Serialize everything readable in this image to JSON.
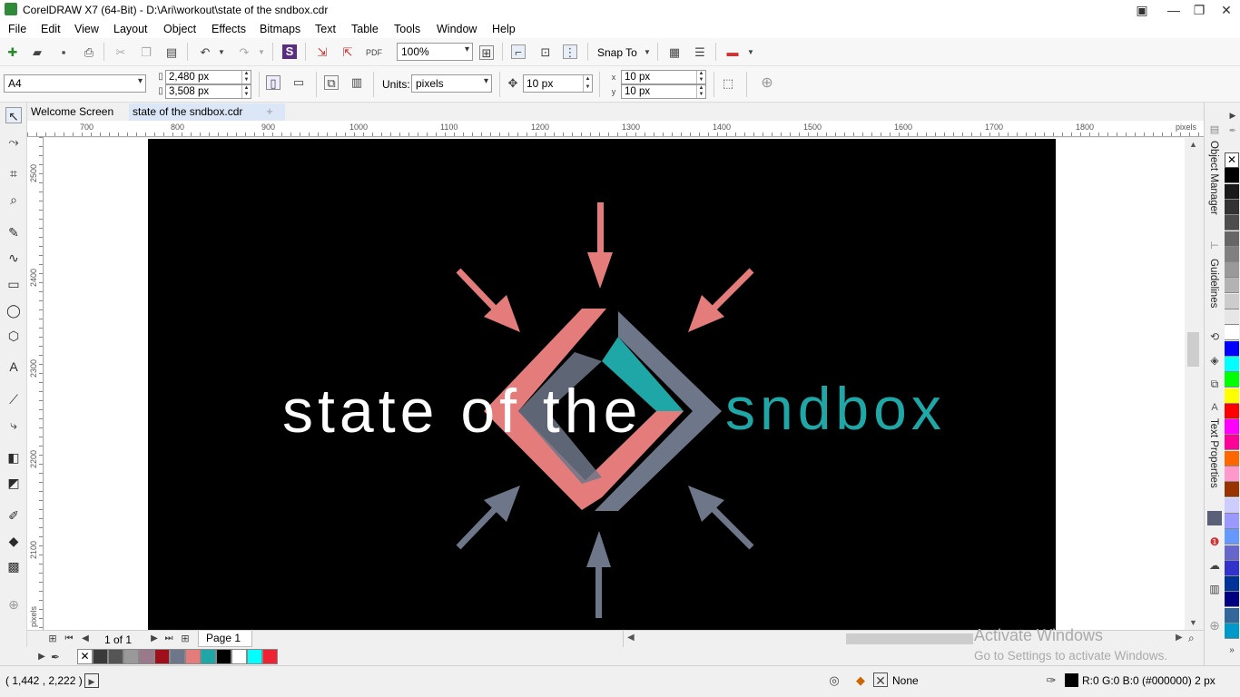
{
  "window": {
    "title": "CorelDRAW X7 (64-Bit) - D:\\Ari\\workout\\state of the sndbox.cdr"
  },
  "menu": [
    "File",
    "Edit",
    "View",
    "Layout",
    "Object",
    "Effects",
    "Bitmaps",
    "Text",
    "Table",
    "Tools",
    "Window",
    "Help"
  ],
  "toolbar": {
    "zoom": "100%",
    "snap_to": "Snap To"
  },
  "property_bar": {
    "page_size": "A4",
    "width": "2,480 px",
    "height": "3,508 px",
    "units_label": "Units:",
    "units": "pixels",
    "nudge": "10 px",
    "dup_x": "10 px",
    "dup_y": "10 px"
  },
  "tabs": [
    {
      "label": "Welcome Screen",
      "active": false
    },
    {
      "label": "state of the sndbox.cdr",
      "active": true
    }
  ],
  "rulers": {
    "horizontal": [
      "700",
      "800",
      "900",
      "1000",
      "1100",
      "1200",
      "1300",
      "1400",
      "1500",
      "1600",
      "1700",
      "1800"
    ],
    "horizontal_unit": "pixels",
    "vertical": [
      "2500",
      "2400",
      "2300",
      "2200",
      "2100"
    ],
    "vertical_unit": "pixels"
  },
  "artwork": {
    "text_left": "state of the",
    "text_right": "sndbox",
    "colors": {
      "background": "#000000",
      "salmon": "#e57c7c",
      "slate": "#6e7789",
      "teal": "#1ea7a6",
      "text": "#ffffff"
    }
  },
  "page_nav": {
    "count": "1 of 1",
    "page_tab": "Page 1"
  },
  "document_palette": [
    "none",
    "#3a3a3a",
    "#555555",
    "#999999",
    "#9a7a8a",
    "#a0101a",
    "#6e7789",
    "#e57c7c",
    "#1ea7a6",
    "#000000",
    "#ffffff",
    "#00ffff",
    "#ee2233"
  ],
  "right_palette": [
    "none",
    "#000000",
    "#1a1a1a",
    "#333333",
    "#4d4d4d",
    "#666666",
    "#808080",
    "#999999",
    "#b3b3b3",
    "#cccccc",
    "#e6e6e6",
    "#ffffff",
    "#0000ff",
    "#00ffff",
    "#00ff00",
    "#ffff00",
    "#ff0000",
    "#ff00ff",
    "#ff0099",
    "#ff6600",
    "#ff99cc",
    "#993300",
    "#ccccff",
    "#9999ff",
    "#6699ff",
    "#6666cc",
    "#3333cc",
    "#003399",
    "#000080",
    "#336699",
    "#0099cc"
  ],
  "dockers": {
    "object_manager": "Object Manager",
    "guidelines": "Guidelines",
    "text_properties": "Text Properties"
  },
  "status": {
    "coords": "( 1,442 , 2,222 )",
    "fill": "None",
    "outline": "R:0 G:0 B:0 (#000000)  2 px"
  },
  "watermark": {
    "line1": "Activate Windows",
    "line2": "Go to Settings to activate Windows."
  }
}
